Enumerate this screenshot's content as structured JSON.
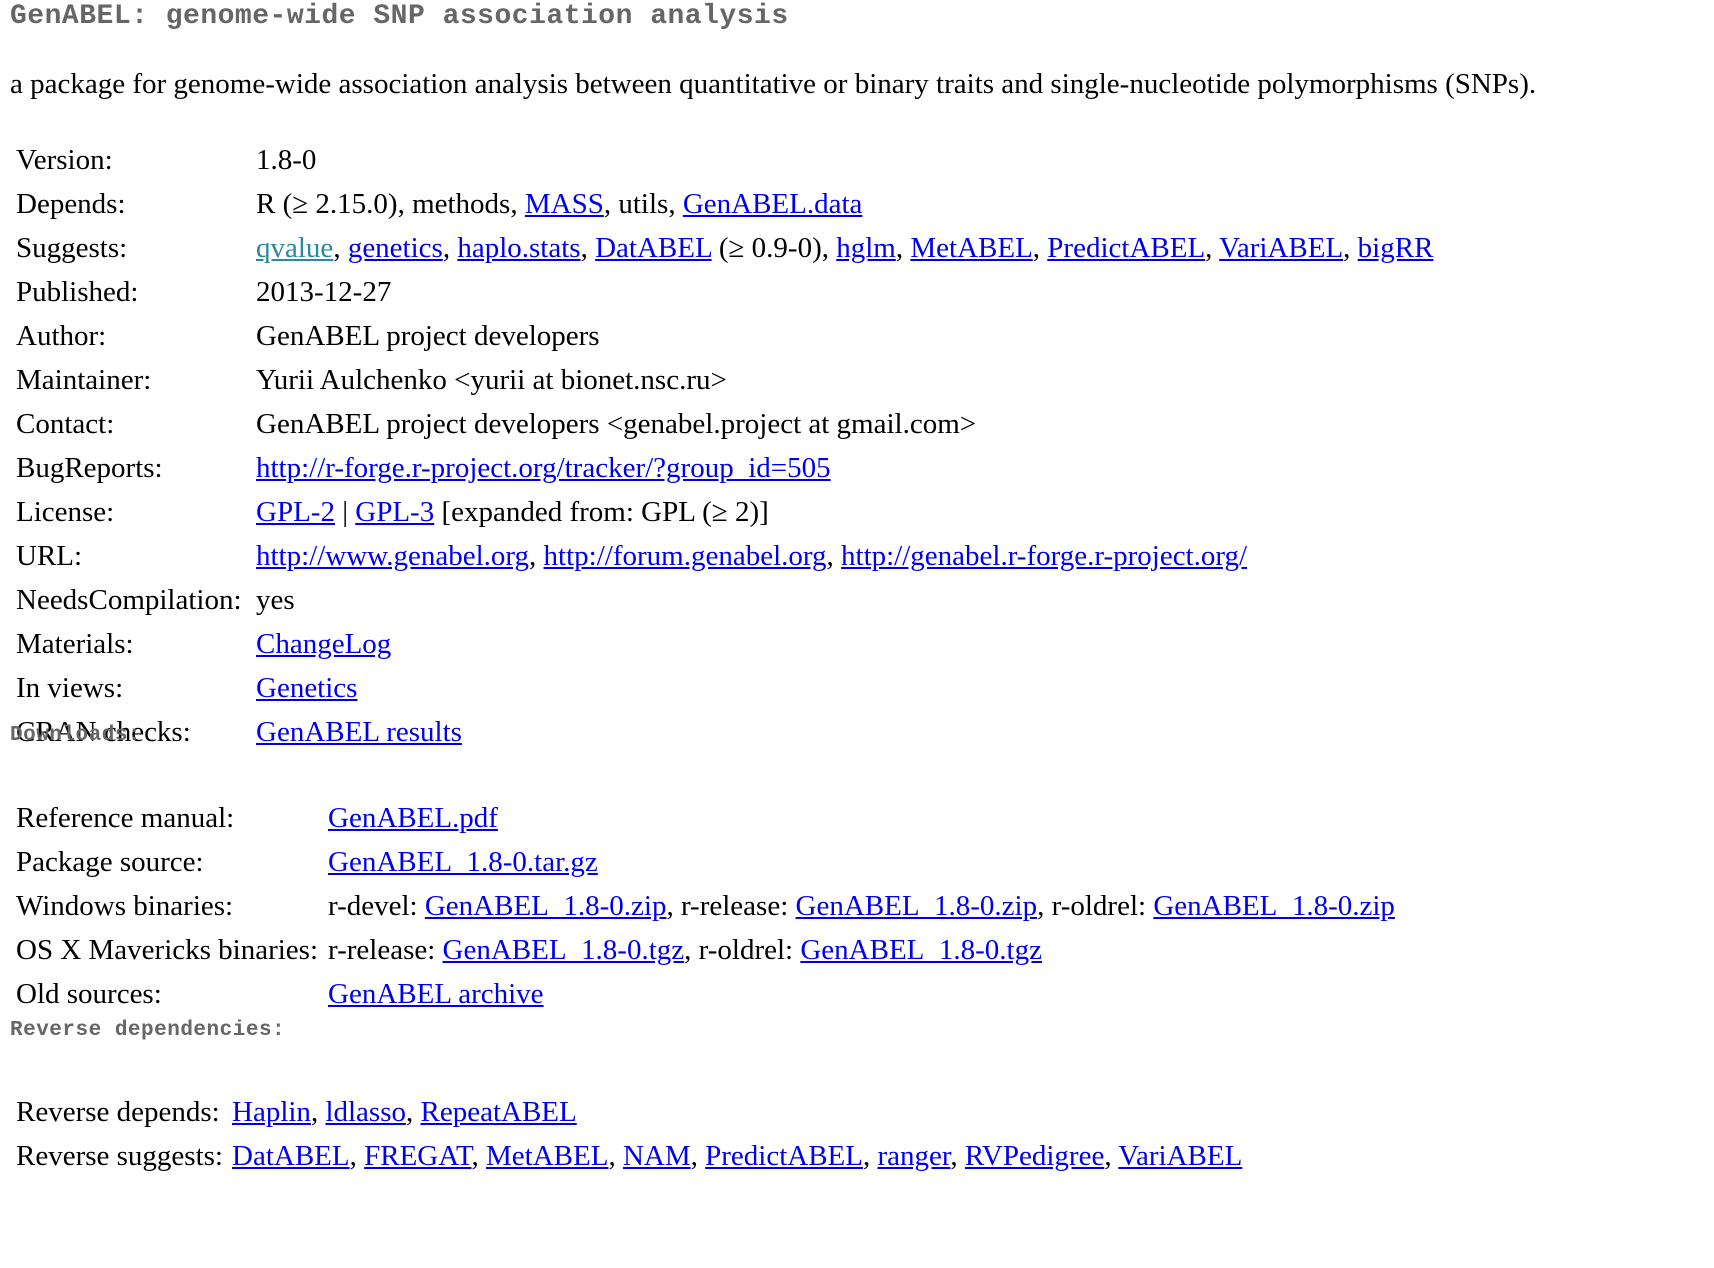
{
  "title": "GenABEL: genome-wide SNP association analysis",
  "description": "a package for genome-wide association analysis between quantitative or binary traits and single-nucleotide polymorphisms (SNPs).",
  "info": {
    "version": {
      "label": "Version:",
      "value": "1.8-0"
    },
    "depends": {
      "label": "Depends:",
      "r": "R (≥ 2.15.0), methods, ",
      "mass": "MASS",
      "utils": ", utils, ",
      "genabel_data": "GenABEL.data"
    },
    "suggests": {
      "label": "Suggests:",
      "qvalue": "qvalue",
      "genetics": "genetics",
      "haplo_stats": "haplo.stats",
      "databel": "DatABEL",
      "databel_ver": " (≥ 0.9-0), ",
      "hglm": "hglm",
      "metabel": "MetABEL",
      "predictabel": "PredictABEL",
      "variabel": "VariABEL",
      "bigrr": "bigRR",
      "sep": ", "
    },
    "published": {
      "label": "Published:",
      "value": "2013-12-27"
    },
    "author": {
      "label": "Author:",
      "value": "GenABEL project developers"
    },
    "maintainer": {
      "label": "Maintainer:",
      "value": "Yurii Aulchenko <yurii at bionet.nsc.ru>"
    },
    "contact": {
      "label": "Contact:",
      "value": "GenABEL project developers <genabel.project at gmail.com>"
    },
    "bugreports": {
      "label": "BugReports:",
      "link": "http://r-forge.r-project.org/tracker/?group_id=505"
    },
    "license": {
      "label": "License:",
      "gpl2": "GPL-2",
      "sep": " | ",
      "gpl3": "GPL-3",
      "expanded": " [expanded from: GPL (≥ 2)]"
    },
    "url": {
      "label": "URL:",
      "link1": "http://www.genabel.org",
      "link2": "http://forum.genabel.org",
      "link3": "http://genabel.r-forge.r-project.org/",
      "sep": ", "
    },
    "needscompilation": {
      "label": "NeedsCompilation:",
      "value": "yes"
    },
    "materials": {
      "label": "Materials:",
      "link": "ChangeLog"
    },
    "inviews": {
      "label": "In views:",
      "link": "Genetics"
    },
    "cranchecks": {
      "label": "CRAN checks:",
      "link": "GenABEL results"
    }
  },
  "downloads": {
    "heading": "Downloads:",
    "refman": {
      "label": "Reference manual:",
      "link": "GenABEL.pdf"
    },
    "source": {
      "label": "Package source:",
      "link": "GenABEL_1.8-0.tar.gz"
    },
    "windows": {
      "label": "Windows binaries:",
      "devel_label": "r-devel: ",
      "devel": "GenABEL_1.8-0.zip",
      "release_label": ", r-release: ",
      "release": "GenABEL_1.8-0.zip",
      "oldrel_label": ", r-oldrel: ",
      "oldrel": "GenABEL_1.8-0.zip"
    },
    "osx": {
      "label": "OS X Mavericks binaries:",
      "release_label": "r-release: ",
      "release": "GenABEL_1.8-0.tgz",
      "oldrel_label": ", r-oldrel: ",
      "oldrel": "GenABEL_1.8-0.tgz"
    },
    "old": {
      "label": "Old sources:",
      "link": "GenABEL archive"
    }
  },
  "revdeps": {
    "heading": "Reverse dependencies:",
    "depends": {
      "label": "Reverse depends:",
      "items": [
        "Haplin",
        "ldlasso",
        "RepeatABEL"
      ]
    },
    "suggests": {
      "label": "Reverse suggests:",
      "items": [
        "DatABEL",
        "FREGAT",
        "MetABEL",
        "NAM",
        "PredictABEL",
        "ranger",
        "RVPedigree",
        "VariABEL"
      ]
    },
    "sep": ", "
  },
  "colors": {
    "link": "#0000ee",
    "visited_link": "#2a8a9a",
    "heading": "#666666"
  }
}
